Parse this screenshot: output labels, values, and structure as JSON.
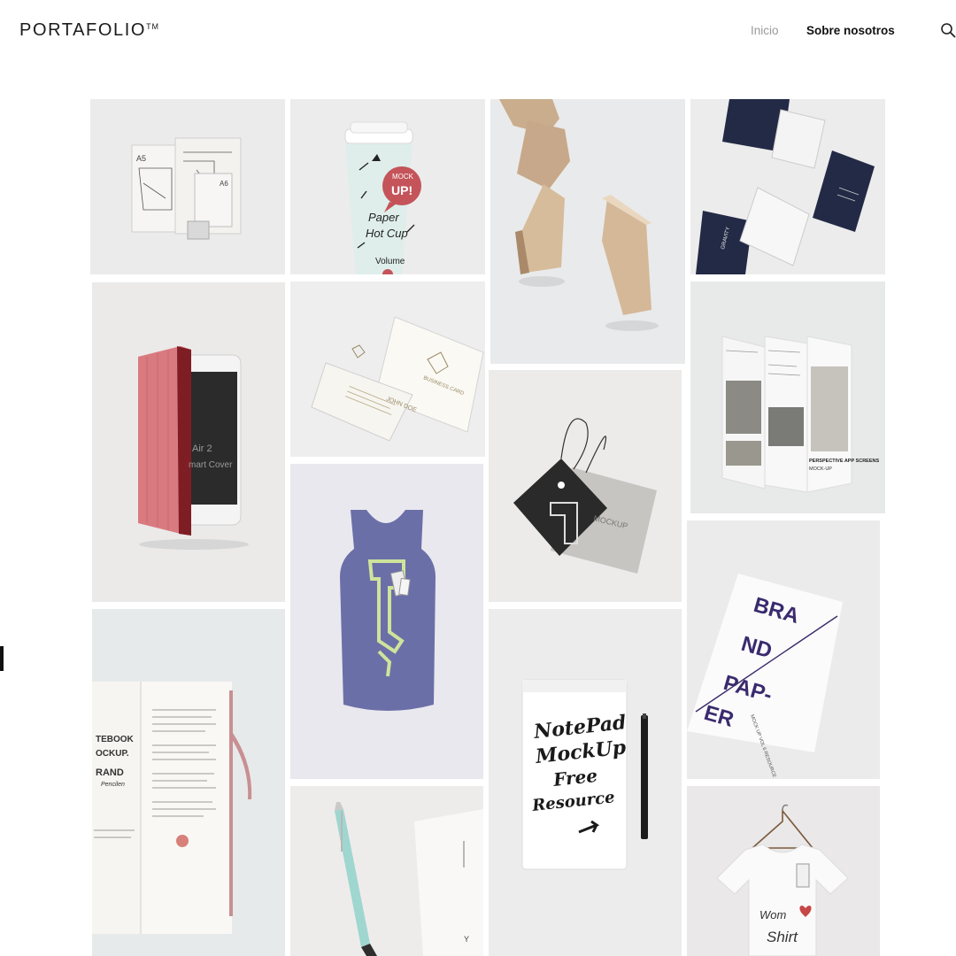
{
  "brand": {
    "name": "PORTAFOLIO",
    "mark": "TM"
  },
  "nav": {
    "inicio": "Inicio",
    "sobre": "Sobre nosotros"
  },
  "icons": {
    "search": "search-icon"
  },
  "colors": {
    "accent_gray": "#9a9a9a",
    "text_dark": "#111111",
    "tile_bg": "#ececec"
  },
  "tiles": {
    "stationery": {
      "a5": "A5",
      "a6": "A6"
    },
    "cup": {
      "mock": "MOCK",
      "up": "UP!",
      "paper": "Paper",
      "hot": "Hot Cup",
      "volume": "Volume"
    },
    "gravity": {
      "word": "GRAVITY"
    },
    "ipad": {
      "line1": "Air 2",
      "line2": "mart Cover"
    },
    "business": {
      "title": "BUSINESS CARD",
      "name": "JOHN DOE"
    },
    "tag": {
      "text": "MOCKUP"
    },
    "app": {
      "title": "PERSPECTIVE APP SCREENS",
      "sub": "MOCK-UP"
    },
    "brand_paper": {
      "l1": "BRA",
      "l2": "ND",
      "l3": "PAP-",
      "l4": "ER",
      "sub": "MOCK UP VOL 6 RESOURCE"
    },
    "notebook": {
      "l1": "TEBOOK",
      "l2": "OCKUP.",
      "l3": "RAND",
      "l4": "Pencilen"
    },
    "notepad": {
      "l1": "NotePad",
      "l2": "MockUp",
      "l3": "Free",
      "l4": "Resource"
    },
    "tshirt": {
      "l1": "Wom",
      "l2": "Shirt"
    }
  }
}
